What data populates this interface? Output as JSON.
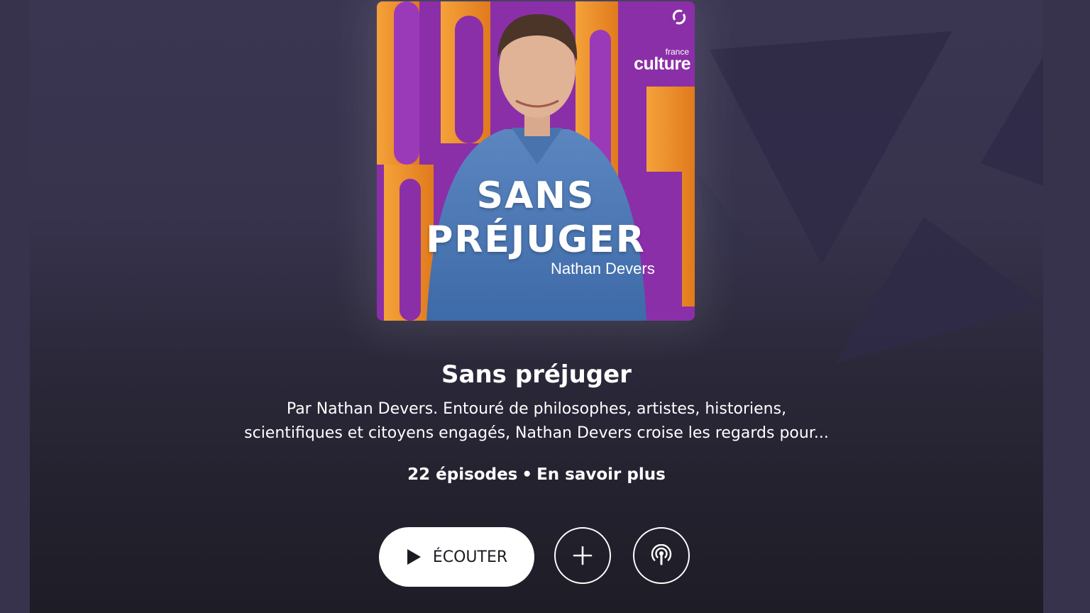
{
  "cover": {
    "title_line1": "SANS",
    "title_line2": "PRÉJUGER",
    "author": "Nathan Devers",
    "brand_small": "france",
    "brand_large": "culture"
  },
  "podcast": {
    "title": "Sans préjuger",
    "description_line1": "Par Nathan Devers. Entouré de philosophes, artistes, historiens,",
    "description_line2": "scientifiques et citoyens engagés, Nathan Devers croise les regards pour...",
    "episodes": "22 épisodes",
    "separator": "•",
    "more_link": "En savoir plus"
  },
  "actions": {
    "listen_label": "ÉCOUTER",
    "add_icon": "plus-icon",
    "feed_icon": "podcast-icon",
    "play_icon": "play-icon"
  },
  "colors": {
    "page_background": "#37334d",
    "cover_purple": "#8b2fa8",
    "cover_orange": "#f0952a",
    "button_background": "#ffffff"
  }
}
